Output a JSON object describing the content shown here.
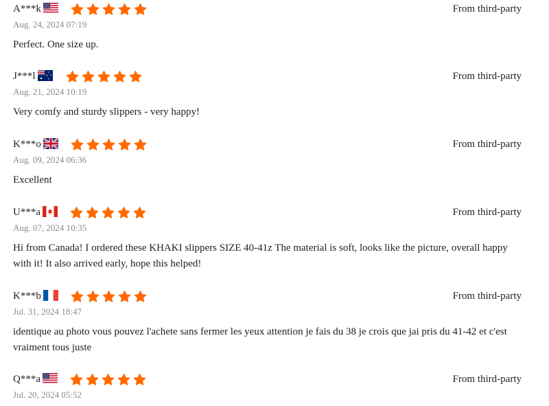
{
  "colors": {
    "star": "#ff6a00",
    "date": "#8a8a8a",
    "text": "#222222"
  },
  "reviews": [
    {
      "user": "A***k",
      "flag": "us-flag-icon",
      "rating": 5,
      "date": "Aug. 24, 2024 07:19",
      "text": "Perfect. One size up.",
      "source": "From third-party"
    },
    {
      "user": "J***l",
      "flag": "au-flag-icon",
      "rating": 5,
      "date": "Aug. 21, 2024 10:19",
      "text": "Very comfy and sturdy slippers - very happy!",
      "source": "From third-party"
    },
    {
      "user": "K***o",
      "flag": "uk-flag-icon",
      "rating": 5,
      "date": "Aug. 09, 2024 06:36",
      "text": "Excellent",
      "source": "From third-party"
    },
    {
      "user": "U***a",
      "flag": "ca-flag-icon",
      "rating": 5,
      "date": "Aug. 07, 2024 10:35",
      "text": "Hi from Canada! I ordered these KHAKI slippers SIZE 40-41z The material is soft, looks like the picture, overall happy with it! It also arrived early, hope this helped!",
      "source": "From third-party"
    },
    {
      "user": "K***b",
      "flag": "fr-flag-icon",
      "rating": 5,
      "date": "Jul. 31, 2024 18:47",
      "text": "identique au photo vous pouvez l'achete sans fermer les yeux attention je fais du 38 je crois que jai pris du 41-42 et c'est vraiment tous juste",
      "source": "From third-party"
    },
    {
      "user": "Q***a",
      "flag": "us-flag-icon",
      "rating": 5,
      "date": "Jul. 20, 2024 05:52",
      "text": "",
      "source": "From third-party"
    }
  ]
}
